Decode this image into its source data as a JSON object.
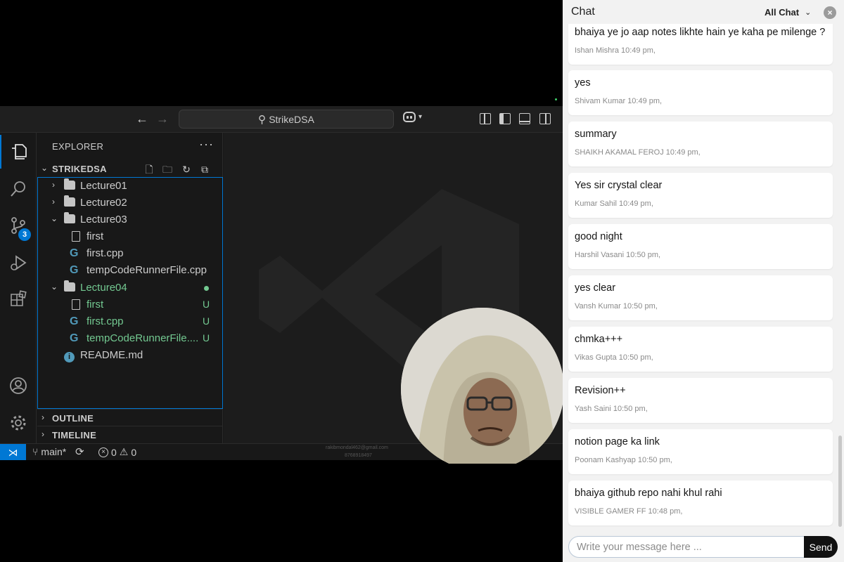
{
  "vscode": {
    "search_label": "StrikeDSA",
    "explorer_title": "EXPLORER",
    "explorer_more": "···",
    "workspace_name": "STRIKEDSA",
    "scm_badge": "3",
    "tree": [
      {
        "label": "Lecture01",
        "type": "folder",
        "expanded": false,
        "status": ""
      },
      {
        "label": "Lecture02",
        "type": "folder",
        "expanded": false,
        "status": ""
      },
      {
        "label": "Lecture03",
        "type": "folder",
        "expanded": true,
        "status": ""
      },
      {
        "label": "first",
        "type": "file",
        "status": ""
      },
      {
        "label": "first.cpp",
        "type": "cpp",
        "status": ""
      },
      {
        "label": "tempCodeRunnerFile.cpp",
        "type": "cpp",
        "status": ""
      },
      {
        "label": "Lecture04",
        "type": "folder",
        "expanded": true,
        "status": "dot"
      },
      {
        "label": "first",
        "type": "file",
        "status": "U"
      },
      {
        "label": "first.cpp",
        "type": "cpp",
        "status": "U"
      },
      {
        "label": "tempCodeRunnerFile....",
        "type": "cpp",
        "status": "U"
      },
      {
        "label": "README.md",
        "type": "info",
        "status": ""
      }
    ],
    "outline_label": "OUTLINE",
    "timeline_label": "TIMELINE",
    "status": {
      "branch": "main*",
      "errors": "0",
      "warnings": "0",
      "watermark_email": "rakibmondal462@gmail.com",
      "watermark_phone": "8768918497"
    }
  },
  "chat": {
    "title": "Chat",
    "filter": "All Chat",
    "messages": [
      {
        "text": "bhaiya ye jo aap notes likhte hain ye kaha pe milenge ?",
        "meta": "Ishan Mishra 10:49 pm,"
      },
      {
        "text": "yes",
        "meta": "Shivam Kumar 10:49 pm,"
      },
      {
        "text": "summary",
        "meta": "SHAIKH AKAMAL FEROJ 10:49 pm,"
      },
      {
        "text": "Yes sir crystal clear",
        "meta": "Kumar Sahil 10:49 pm,"
      },
      {
        "text": "good night",
        "meta": "Harshil Vasani 10:50 pm,"
      },
      {
        "text": "yes clear",
        "meta": "Vansh Kumar 10:50 pm,"
      },
      {
        "text": "chmka+++",
        "meta": "Vikas Gupta 10:50 pm,"
      },
      {
        "text": "Revision++",
        "meta": "Yash Saini 10:50 pm,"
      },
      {
        "text": "notion page ka link",
        "meta": "Poonam Kashyap 10:50 pm,"
      },
      {
        "text": "bhaiya github repo nahi khul rahi",
        "meta": "VISIBLE GAMER FF 10:48 pm,"
      }
    ],
    "input_placeholder": "Write your message here ...",
    "send_label": "Send"
  },
  "colors": {
    "accent": "#0078d4",
    "git_untracked": "#73c991",
    "cpp_icon": "#519aba"
  }
}
